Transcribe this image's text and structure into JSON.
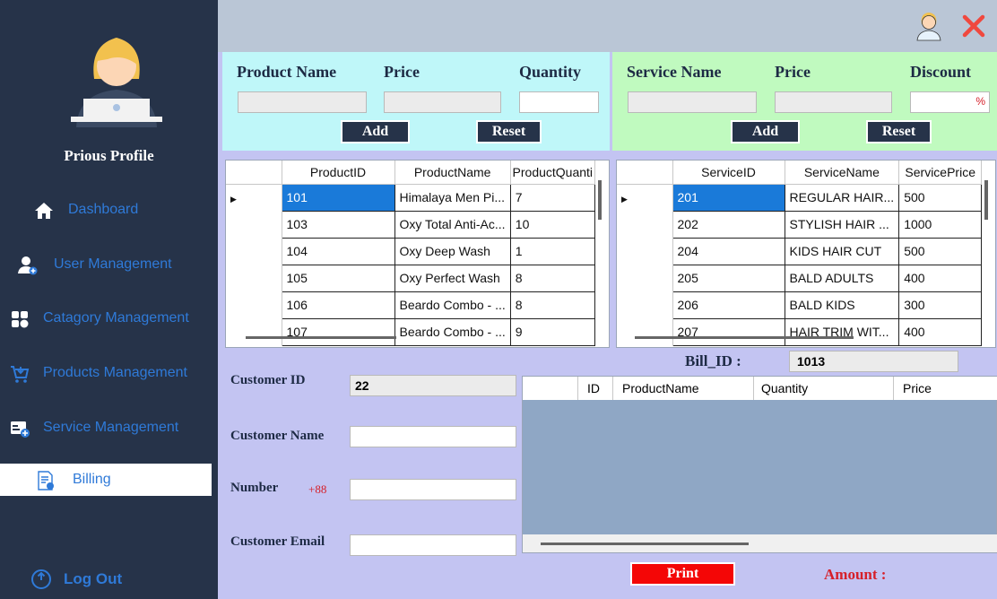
{
  "sidebar": {
    "profile_name": "Prious  Profile",
    "nav": [
      {
        "label": "Dashboard",
        "icon": "home-icon"
      },
      {
        "label": "User Management",
        "icon": "add-user-icon"
      },
      {
        "label": "Catagory Management",
        "icon": "category-icon"
      },
      {
        "label": "Products Management",
        "icon": "cart-icon"
      },
      {
        "label": "Service Management",
        "icon": "service-icon"
      },
      {
        "label": "Billing",
        "icon": "bill-icon"
      }
    ],
    "logout_label": "Log Out"
  },
  "product_form": {
    "name_label": "Product Name",
    "price_label": "Price",
    "quantity_label": "Quantity",
    "add_label": "Add",
    "reset_label": "Reset"
  },
  "service_form": {
    "name_label": "Service Name",
    "price_label": "Price",
    "discount_label": "Discount",
    "discount_unit": "%",
    "add_label": "Add",
    "reset_label": "Reset"
  },
  "product_table": {
    "columns": [
      "ProductID",
      "ProductName",
      "ProductQuanti"
    ],
    "rows": [
      [
        "101",
        "Himalaya Men Pi...",
        "7"
      ],
      [
        "103",
        "Oxy Total Anti-Ac...",
        "10"
      ],
      [
        "104",
        "Oxy Deep Wash",
        "1"
      ],
      [
        "105",
        "Oxy Perfect Wash",
        "8"
      ],
      [
        "106",
        "Beardo Combo - ...",
        "8"
      ],
      [
        "107",
        "Beardo Combo - ...",
        "9"
      ]
    ]
  },
  "service_table": {
    "columns": [
      "ServiceID",
      "ServiceName",
      "ServicePrice"
    ],
    "rows": [
      [
        "201",
        "REGULAR HAIR...",
        "500"
      ],
      [
        "202",
        "STYLISH HAIR ...",
        "1000"
      ],
      [
        "204",
        "KIDS HAIR CUT",
        "500"
      ],
      [
        "205",
        "BALD ADULTS",
        "400"
      ],
      [
        "206",
        "BALD KIDS",
        "300"
      ],
      [
        "207",
        "HAIR TRIM WIT...",
        "400"
      ]
    ]
  },
  "billing": {
    "bill_id_label": "Bill_ID :",
    "bill_id_value": "1013",
    "customer_id_label": "Customer ID",
    "customer_id_value": "22",
    "customer_name_label": "Customer Name",
    "number_label": "Number",
    "number_prefix": "+88",
    "customer_email_label": "Customer Email",
    "grid_columns": [
      "ID",
      "ProductName",
      "Quantity",
      "Price"
    ],
    "print_label": "Print",
    "amount_label": "Amount :"
  },
  "colors": {
    "sidebar": "#263349",
    "accent": "#2f7ad8",
    "product_panel": "#bff7f9",
    "service_panel": "#c0fabf",
    "main_bg": "#c3c4f2",
    "print_button": "#f40606"
  }
}
